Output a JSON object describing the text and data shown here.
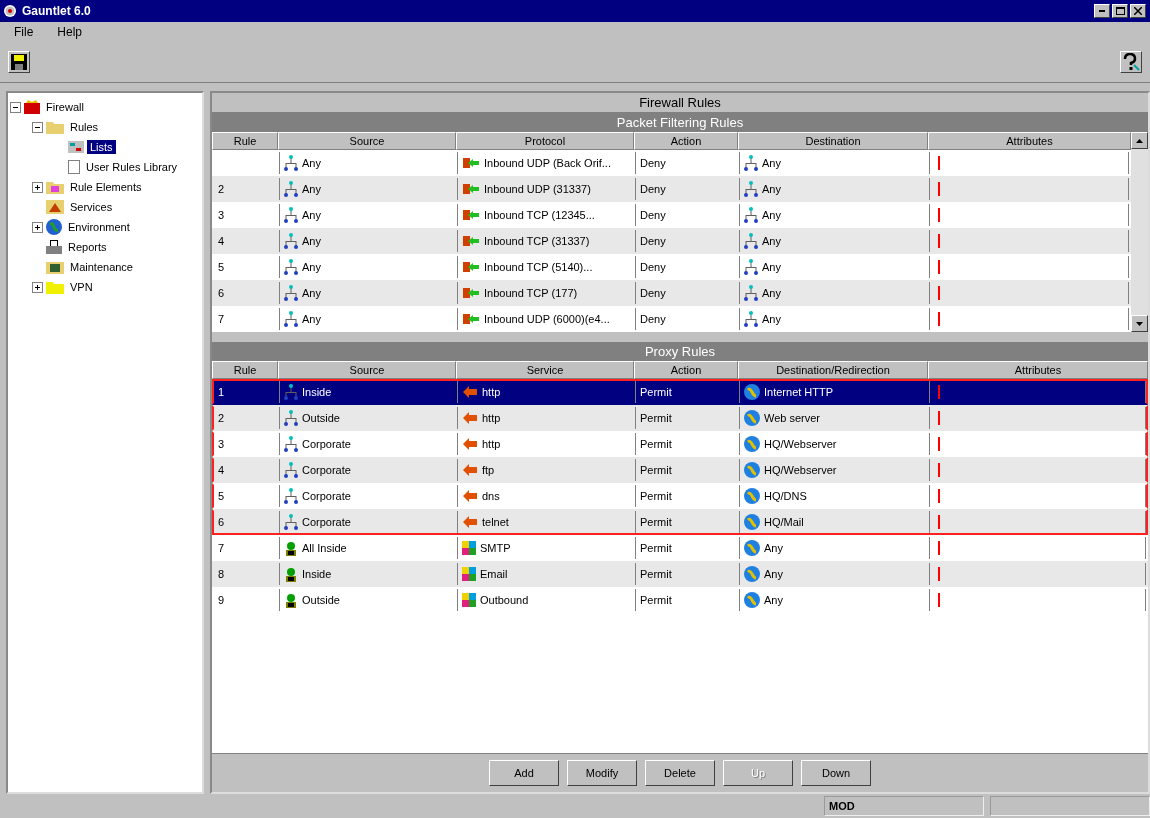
{
  "window": {
    "title": "Gauntlet 6.0"
  },
  "menu": [
    "File",
    "Help"
  ],
  "tree": [
    {
      "label": "Firewall",
      "kind": "firewall",
      "expanded": true,
      "selected": false,
      "children": [
        {
          "label": "Rules",
          "kind": "folder",
          "expanded": true,
          "selected": false,
          "children": [
            {
              "label": "Lists",
              "kind": "list",
              "selected": true
            },
            {
              "label": "User Rules Library",
              "kind": "page",
              "selected": false
            }
          ]
        },
        {
          "label": "Rule Elements",
          "kind": "elements",
          "expanded": false,
          "selected": false
        },
        {
          "label": "Services",
          "kind": "services",
          "selected": false
        },
        {
          "label": "Environment",
          "kind": "globe",
          "expanded": false,
          "selected": false
        },
        {
          "label": "Reports",
          "kind": "reports",
          "selected": false
        },
        {
          "label": "Maintenance",
          "kind": "maintenance",
          "selected": false
        },
        {
          "label": "VPN",
          "kind": "vpn",
          "expanded": false,
          "selected": false
        }
      ]
    }
  ],
  "panel_title": "Firewall Rules",
  "packet": {
    "title": "Packet Filtering Rules",
    "columns": [
      "Rule",
      "Source",
      "Protocol",
      "Action",
      "Destination",
      "Attributes"
    ],
    "rows": [
      {
        "rule": "",
        "source": "Any",
        "protocol": "Inbound UDP (Back Orif...",
        "action": "Deny",
        "destination": "Any"
      },
      {
        "rule": "2",
        "source": "Any",
        "protocol": "Inbound UDP (31337)",
        "action": "Deny",
        "destination": "Any"
      },
      {
        "rule": "3",
        "source": "Any",
        "protocol": "Inbound TCP (12345...",
        "action": "Deny",
        "destination": "Any"
      },
      {
        "rule": "4",
        "source": "Any",
        "protocol": "Inbound TCP (31337)",
        "action": "Deny",
        "destination": "Any"
      },
      {
        "rule": "5",
        "source": "Any",
        "protocol": "Inbound TCP (5140)...",
        "action": "Deny",
        "destination": "Any"
      },
      {
        "rule": "6",
        "source": "Any",
        "protocol": "Inbound TCP (177)",
        "action": "Deny",
        "destination": "Any"
      },
      {
        "rule": "7",
        "source": "Any",
        "protocol": "Inbound UDP (6000)(e4...",
        "action": "Deny",
        "destination": "Any"
      }
    ]
  },
  "proxy": {
    "title": "Proxy Rules",
    "columns": [
      "Rule",
      "Source",
      "Service",
      "Action",
      "Destination/Redirection",
      "Attributes"
    ],
    "rows": [
      {
        "rule": "1",
        "kind": "network",
        "source": "Inside",
        "service": "http",
        "action": "Permit",
        "destination": "Internet HTTP",
        "selected": true,
        "highlighted": true
      },
      {
        "rule": "2",
        "kind": "network",
        "source": "Outside",
        "service": "http",
        "action": "Permit",
        "destination": "Web server",
        "selected": false,
        "highlighted": true
      },
      {
        "rule": "3",
        "kind": "network",
        "source": "Corporate",
        "service": "http",
        "action": "Permit",
        "destination": "HQ/Webserver",
        "selected": false,
        "highlighted": true
      },
      {
        "rule": "4",
        "kind": "network",
        "source": "Corporate",
        "service": "ftp",
        "action": "Permit",
        "destination": "HQ/Webserver",
        "selected": false,
        "highlighted": true
      },
      {
        "rule": "5",
        "kind": "network",
        "source": "Corporate",
        "service": "dns",
        "action": "Permit",
        "destination": "HQ/DNS",
        "selected": false,
        "highlighted": true
      },
      {
        "rule": "6",
        "kind": "network",
        "source": "Corporate",
        "service": "telnet",
        "action": "Permit",
        "destination": "HQ/Mail",
        "selected": false,
        "highlighted": true
      },
      {
        "rule": "7",
        "kind": "user",
        "source": "All Inside",
        "service": "SMTP",
        "action": "Permit",
        "destination": "Any",
        "selected": false,
        "highlighted": false
      },
      {
        "rule": "8",
        "kind": "user",
        "source": "Inside",
        "service": "Email",
        "action": "Permit",
        "destination": "Any",
        "selected": false,
        "highlighted": false
      },
      {
        "rule": "9",
        "kind": "user",
        "source": "Outside",
        "service": "Outbound",
        "action": "Permit",
        "destination": "Any",
        "selected": false,
        "highlighted": false
      }
    ]
  },
  "buttons": [
    {
      "label": "Add",
      "disabled": false
    },
    {
      "label": "Modify",
      "disabled": false
    },
    {
      "label": "Delete",
      "disabled": false
    },
    {
      "label": "Up",
      "disabled": true
    },
    {
      "label": "Down",
      "disabled": false
    }
  ],
  "status_bar": {
    "mode": "MOD"
  }
}
